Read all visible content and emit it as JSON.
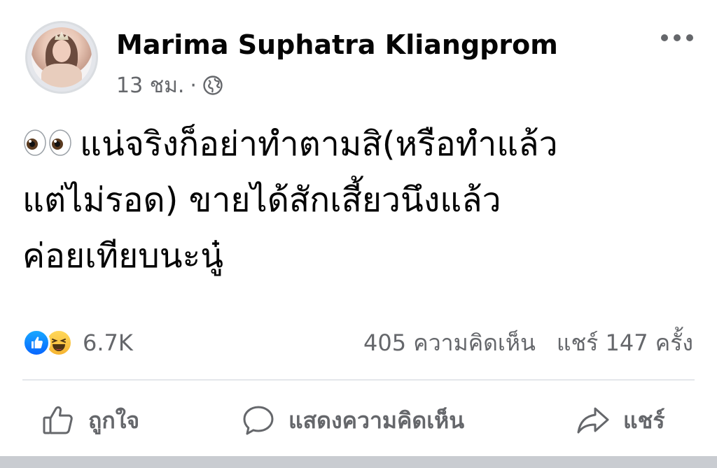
{
  "post": {
    "author_name": "Marima Suphatra Kliangprom",
    "timestamp": "13 ชม.",
    "separator": "·",
    "privacy_icon": "globe-icon",
    "lead_emoji": "eyes-icon",
    "text_lines": [
      "แน่จริงก็อย่าทำตามสิ(หรือทำแล้ว",
      "แต่ไม่รอด) ขายได้สักเสี้ยวนึงแล้ว",
      "ค่อยเทียบนะนู๋"
    ]
  },
  "reactions": {
    "icons": [
      "like-icon",
      "haha-icon"
    ],
    "count": "6.7K"
  },
  "engagement": {
    "comments": "405 ความคิดเห็น",
    "shares": "แชร์ 147 ครั้ง"
  },
  "actions": {
    "like_label": "ถูกใจ",
    "comment_label": "แสดงความคิดเห็น",
    "share_label": "แชร์"
  },
  "colors": {
    "text_primary": "#050505",
    "text_secondary": "#65676b",
    "like_blue": "#0866ff",
    "haha_yellow": "#f6b431",
    "divider": "#e4e6eb"
  }
}
